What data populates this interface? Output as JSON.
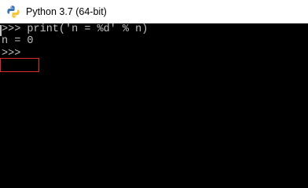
{
  "window": {
    "title": "Python 3.7 (64-bit)",
    "icon": "python-icon"
  },
  "console": {
    "lines": [
      ">>> print('n = %d' % n)",
      "n = 0",
      ">>>"
    ]
  },
  "colors": {
    "console_background": "#000000",
    "console_text": "#c0c0c0",
    "highlight_border": "#e02828",
    "titlebar_background": "#ffffff"
  }
}
